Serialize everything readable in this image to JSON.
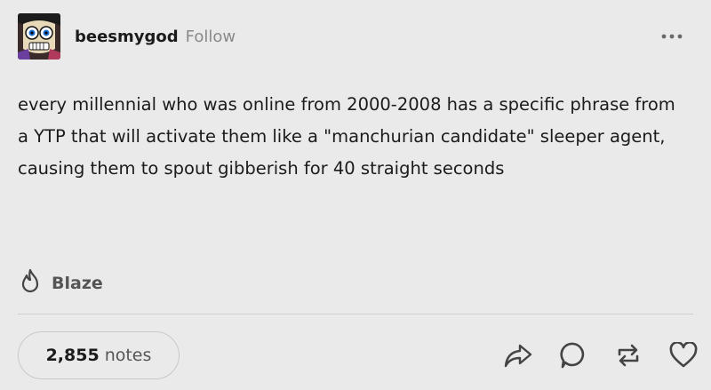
{
  "post": {
    "username": "beesmygod",
    "follow_label": "Follow",
    "body": "every millennial who was online from 2000-2008 has a specific phrase from a YTP that will activate them like a \"manchurian candidate\" sleeper agent, causing them to spout gibberish for 40 straight seconds"
  },
  "footer": {
    "blaze_label": "Blaze",
    "notes_count": "2,855",
    "notes_label": "notes"
  },
  "icons": {
    "more": "more-icon",
    "blaze": "flame-icon",
    "share": "share-icon",
    "reply": "reply-icon",
    "reblog": "reblog-icon",
    "like": "heart-icon"
  },
  "colors": {
    "background": "#eaeaea",
    "text": "#1b1b1b",
    "muted": "#8a8a8a"
  }
}
